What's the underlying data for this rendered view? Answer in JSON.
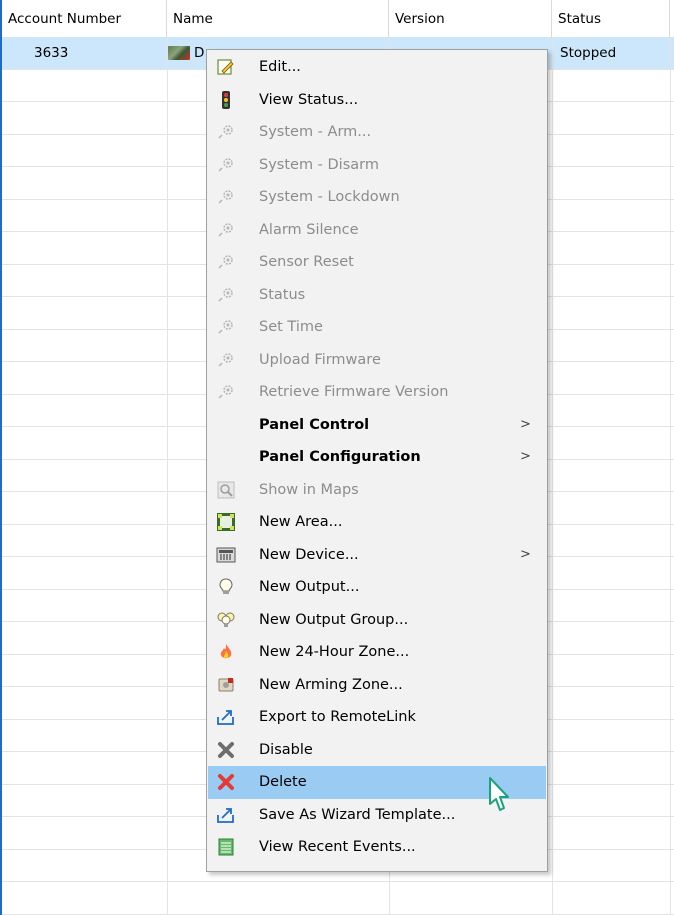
{
  "grid": {
    "columns": [
      "Account Number",
      "Name",
      "Version",
      "Status"
    ],
    "row": {
      "account": "3633",
      "name_visible": "D",
      "version_visible": "",
      "status": "Stopped"
    }
  },
  "menu": {
    "items": [
      {
        "label": "Edit...",
        "icon": "edit-icon",
        "state": "enabled"
      },
      {
        "label": "View Status...",
        "icon": "traffic-light-icon",
        "state": "enabled"
      },
      {
        "label": "System - Arm...",
        "icon": "gear-command-icon",
        "state": "disabled"
      },
      {
        "label": "System - Disarm",
        "icon": "gear-command-icon",
        "state": "disabled"
      },
      {
        "label": "System - Lockdown",
        "icon": "gear-command-icon",
        "state": "disabled"
      },
      {
        "label": "Alarm Silence",
        "icon": "gear-command-icon",
        "state": "disabled"
      },
      {
        "label": "Sensor Reset",
        "icon": "gear-command-icon",
        "state": "disabled"
      },
      {
        "label": "Status",
        "icon": "gear-command-icon",
        "state": "disabled"
      },
      {
        "label": "Set Time",
        "icon": "gear-command-icon",
        "state": "disabled"
      },
      {
        "label": "Upload Firmware",
        "icon": "gear-command-icon",
        "state": "disabled"
      },
      {
        "label": "Retrieve Firmware Version",
        "icon": "gear-command-icon",
        "state": "disabled"
      },
      {
        "label": "Panel Control",
        "icon": "",
        "state": "enabled",
        "bold": true,
        "submenu": true
      },
      {
        "label": "Panel Configuration",
        "icon": "",
        "state": "enabled",
        "bold": true,
        "submenu": true
      },
      {
        "label": "Show in Maps",
        "icon": "map-search-icon",
        "state": "disabled"
      },
      {
        "label": "New Area...",
        "icon": "area-icon",
        "state": "enabled"
      },
      {
        "label": "New Device...",
        "icon": "device-icon",
        "state": "enabled",
        "submenu": true
      },
      {
        "label": "New Output...",
        "icon": "lightbulb-icon",
        "state": "enabled"
      },
      {
        "label": "New Output Group...",
        "icon": "lightbulb-group-icon",
        "state": "enabled"
      },
      {
        "label": "New 24-Hour Zone...",
        "icon": "flame-icon",
        "state": "enabled"
      },
      {
        "label": "New Arming Zone...",
        "icon": "arming-zone-icon",
        "state": "enabled"
      },
      {
        "label": "Export to RemoteLink",
        "icon": "export-icon",
        "state": "enabled"
      },
      {
        "label": "Disable",
        "icon": "disable-x-icon",
        "state": "enabled"
      },
      {
        "label": "Delete",
        "icon": "delete-x-icon",
        "state": "highlighted"
      },
      {
        "label": "Save As Wizard Template...",
        "icon": "export-icon",
        "state": "enabled"
      },
      {
        "label": "View Recent Events...",
        "icon": "event-list-icon",
        "state": "enabled"
      }
    ],
    "submenu_glyph": ">"
  },
  "colors": {
    "selection_row": "#cce6fb",
    "menu_highlight": "#99cbf3",
    "window_border": "#1e6cc9",
    "cursor_outline": "#1aa37a"
  }
}
